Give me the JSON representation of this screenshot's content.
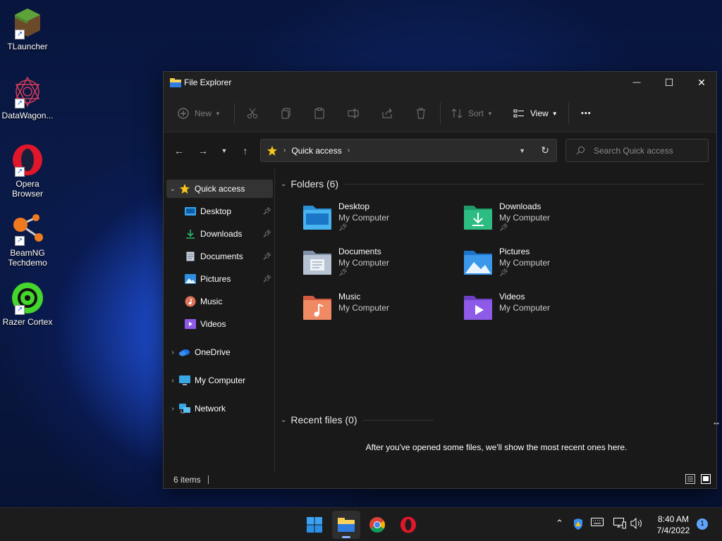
{
  "desktop": {
    "icons": [
      {
        "label": "TLauncher"
      },
      {
        "label": "DataWagon..."
      },
      {
        "label": "Opera Browser"
      },
      {
        "label": "BeamNG Techdemo"
      },
      {
        "label": "Razer Cortex"
      }
    ]
  },
  "window": {
    "title": "File Explorer",
    "controls": {
      "minimize": "—",
      "maximize": "☐",
      "close": "✕"
    }
  },
  "commandbar": {
    "new_label": "New",
    "sort_label": "Sort",
    "view_label": "View",
    "more_label": "•••"
  },
  "address": {
    "location": "Quick access",
    "search_placeholder": "Search Quick access"
  },
  "navpane": {
    "quick_access": "Quick access",
    "items": [
      {
        "label": "Desktop",
        "pinned": true
      },
      {
        "label": "Downloads",
        "pinned": true
      },
      {
        "label": "Documents",
        "pinned": true
      },
      {
        "label": "Pictures",
        "pinned": true
      },
      {
        "label": "Music",
        "pinned": false
      },
      {
        "label": "Videos",
        "pinned": false
      }
    ],
    "roots": [
      {
        "label": "OneDrive"
      },
      {
        "label": "My Computer"
      },
      {
        "label": "Network"
      }
    ]
  },
  "content": {
    "folders_header": "Folders (6)",
    "folders": [
      {
        "name": "Desktop",
        "location": "My Computer",
        "pinned": true
      },
      {
        "name": "Downloads",
        "location": "My Computer",
        "pinned": true
      },
      {
        "name": "Documents",
        "location": "My Computer",
        "pinned": true
      },
      {
        "name": "Pictures",
        "location": "My Computer",
        "pinned": true
      },
      {
        "name": "Music",
        "location": "My Computer",
        "pinned": false
      },
      {
        "name": "Videos",
        "location": "My Computer",
        "pinned": false
      }
    ],
    "recent_header": "Recent files (0)",
    "recent_empty": "After you've opened some files, we'll show the most recent ones here."
  },
  "statusbar": {
    "items_count": "6 items"
  },
  "taskbar": {
    "apps": [
      "start-icon",
      "file-explorer-icon",
      "chrome-icon",
      "opera-icon"
    ],
    "time": "8:40 AM",
    "date": "7/4/2022",
    "notification_count": "1"
  }
}
